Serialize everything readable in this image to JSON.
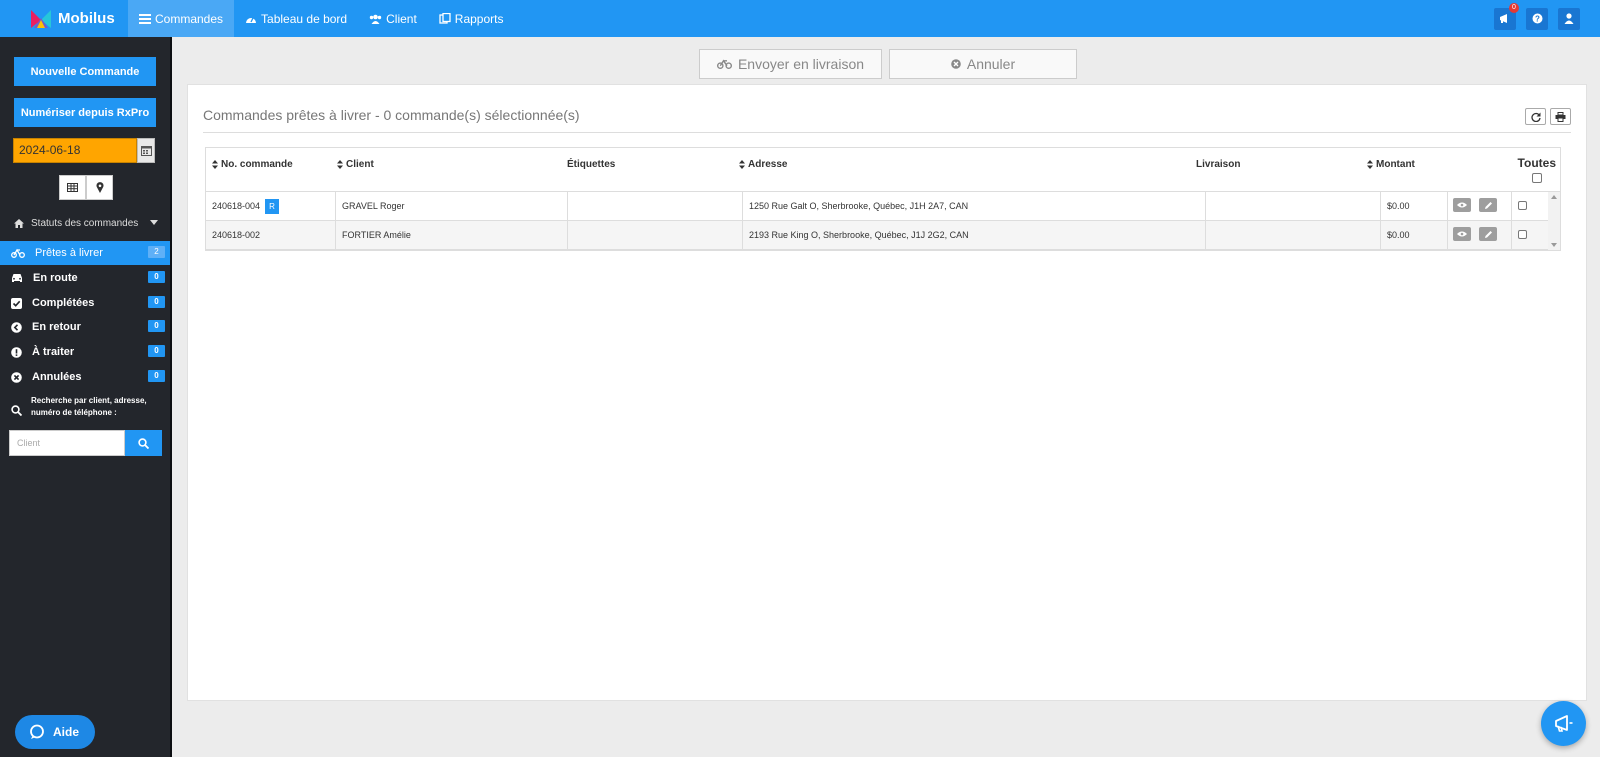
{
  "app": {
    "name": "Mobilus"
  },
  "nav": [
    {
      "label": "Commandes",
      "icon": "list-icon",
      "active": true
    },
    {
      "label": "Tableau de bord",
      "icon": "dashboard-icon"
    },
    {
      "label": "Client",
      "icon": "users-icon"
    },
    {
      "label": "Rapports",
      "icon": "reports-icon"
    }
  ],
  "topright": {
    "notification_count": "0"
  },
  "sidebar": {
    "new_order_label": "Nouvelle Commande",
    "scan_label": "Numériser depuis RxPro",
    "date_value": "2024-06-18",
    "status_header": "Statuts des commandes",
    "statuses": [
      {
        "label": "Prêtes à livrer",
        "count": "2",
        "icon": "truck-icon",
        "active": true
      },
      {
        "label": "En route",
        "count": "0",
        "icon": "car-icon"
      },
      {
        "label": "Complétées",
        "count": "0",
        "icon": "check-square-icon"
      },
      {
        "label": "En retour",
        "count": "0",
        "icon": "arrow-left-circle-icon"
      },
      {
        "label": "À traiter",
        "count": "0",
        "icon": "exclamation-circle-icon"
      },
      {
        "label": "Annulées",
        "count": "0",
        "icon": "times-circle-icon"
      }
    ],
    "search_label": "Recherche par client, adresse, numéro de téléphone :",
    "search_placeholder": "Client",
    "help_label": "Aide"
  },
  "actions": {
    "send_label": "Envoyer en livraison",
    "cancel_label": "Annuler"
  },
  "panel": {
    "title": "Commandes prêtes à livrer - 0 commande(s) sélectionnée(s)"
  },
  "table": {
    "headers": {
      "order_no": "No. commande",
      "client": "Client",
      "labels": "Étiquettes",
      "address": "Adresse",
      "delivery": "Livraison",
      "amount": "Montant",
      "all": "Toutes"
    },
    "rows": [
      {
        "order_no": "240618-004",
        "badge": "R",
        "client": "GRAVEL Roger",
        "labels": "",
        "address": "1250 Rue Galt O, Sherbrooke, Québec, J1H 2A7, CAN",
        "delivery": "",
        "amount": "$0.00"
      },
      {
        "order_no": "240618-002",
        "badge": "",
        "client": "FORTIER Amélie",
        "labels": "",
        "address": "2193 Rue King O, Sherbrooke, Québec, J1J 2G2, CAN",
        "delivery": "",
        "amount": "$0.00"
      }
    ]
  },
  "colors": {
    "primary": "#2196f3",
    "sidebar_bg": "#23262c",
    "date_bg": "#ffa500",
    "page_bg": "#ececec"
  }
}
